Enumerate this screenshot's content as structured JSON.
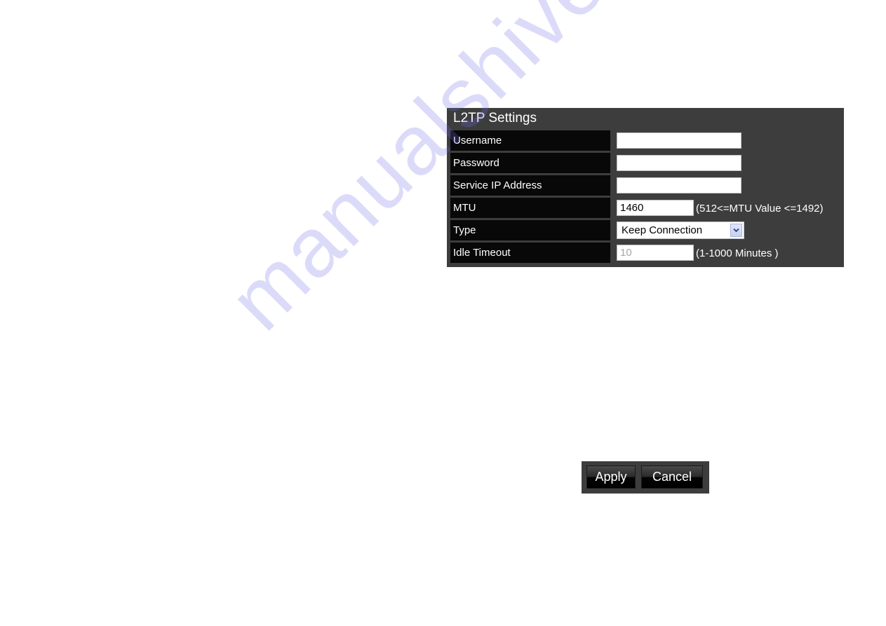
{
  "panel": {
    "title": "L2TP Settings",
    "rows": [
      {
        "label": "Username",
        "value": ""
      },
      {
        "label": "Password",
        "value": ""
      },
      {
        "label": "Service IP Address",
        "value": ""
      },
      {
        "label": "MTU",
        "value": "1460",
        "hint": "(512<=MTU Value <=1492)"
      },
      {
        "label": "Type",
        "selected": "Keep Connection"
      },
      {
        "label": "Idle Timeout",
        "value": "10",
        "hint": "(1-1000 Minutes )",
        "disabled": true
      }
    ]
  },
  "buttons": {
    "apply_label": "Apply",
    "cancel_label": "Cancel"
  },
  "icons": {
    "select_arrow": "chevron-down-icon"
  },
  "watermark": "manualshive.com",
  "colors": {
    "panel_bg": "#3d3d3d",
    "label_bg": "#080808",
    "text": "#ffffff",
    "select_arrow_bg": "#c6d1f2"
  }
}
